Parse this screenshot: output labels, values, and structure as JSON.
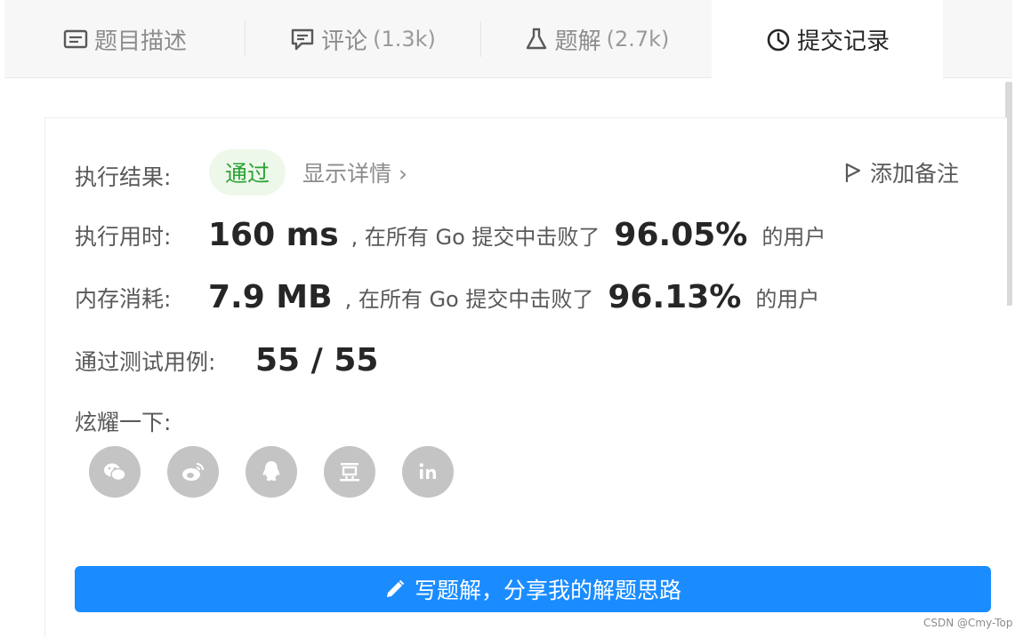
{
  "tabs": [
    {
      "label": "题目描述",
      "count": "",
      "icon": "description-icon"
    },
    {
      "label": "评论",
      "count": "(1.3k)",
      "icon": "comment-icon"
    },
    {
      "label": "题解",
      "count": "(2.7k)",
      "icon": "flask-icon"
    },
    {
      "label": "提交记录",
      "count": "",
      "icon": "clock-icon",
      "active": true
    }
  ],
  "result": {
    "label": "执行结果:",
    "status": "通过",
    "status_color": "#2aa336",
    "detail_link": "显示详情 ›",
    "add_note": "添加备注"
  },
  "runtime": {
    "label": "执行用时:",
    "value": "160 ms",
    "text": ", 在所有 Go 提交中击败了",
    "percent": "96.05%",
    "suffix": "的用户"
  },
  "memory": {
    "label": "内存消耗:",
    "value": "7.9 MB",
    "text": ", 在所有 Go 提交中击败了",
    "percent": "96.13%",
    "suffix": "的用户"
  },
  "tests": {
    "label": "通过测试用例:",
    "value": "55 / 55"
  },
  "share": {
    "label": "炫耀一下:",
    "icons": [
      "wechat-icon",
      "weibo-icon",
      "qq-icon",
      "douban-icon",
      "linkedin-icon"
    ]
  },
  "write_button": "写题解，分享我的解题思路",
  "accent": "#1a8cff",
  "watermark": "CSDN @Cmy-Top"
}
